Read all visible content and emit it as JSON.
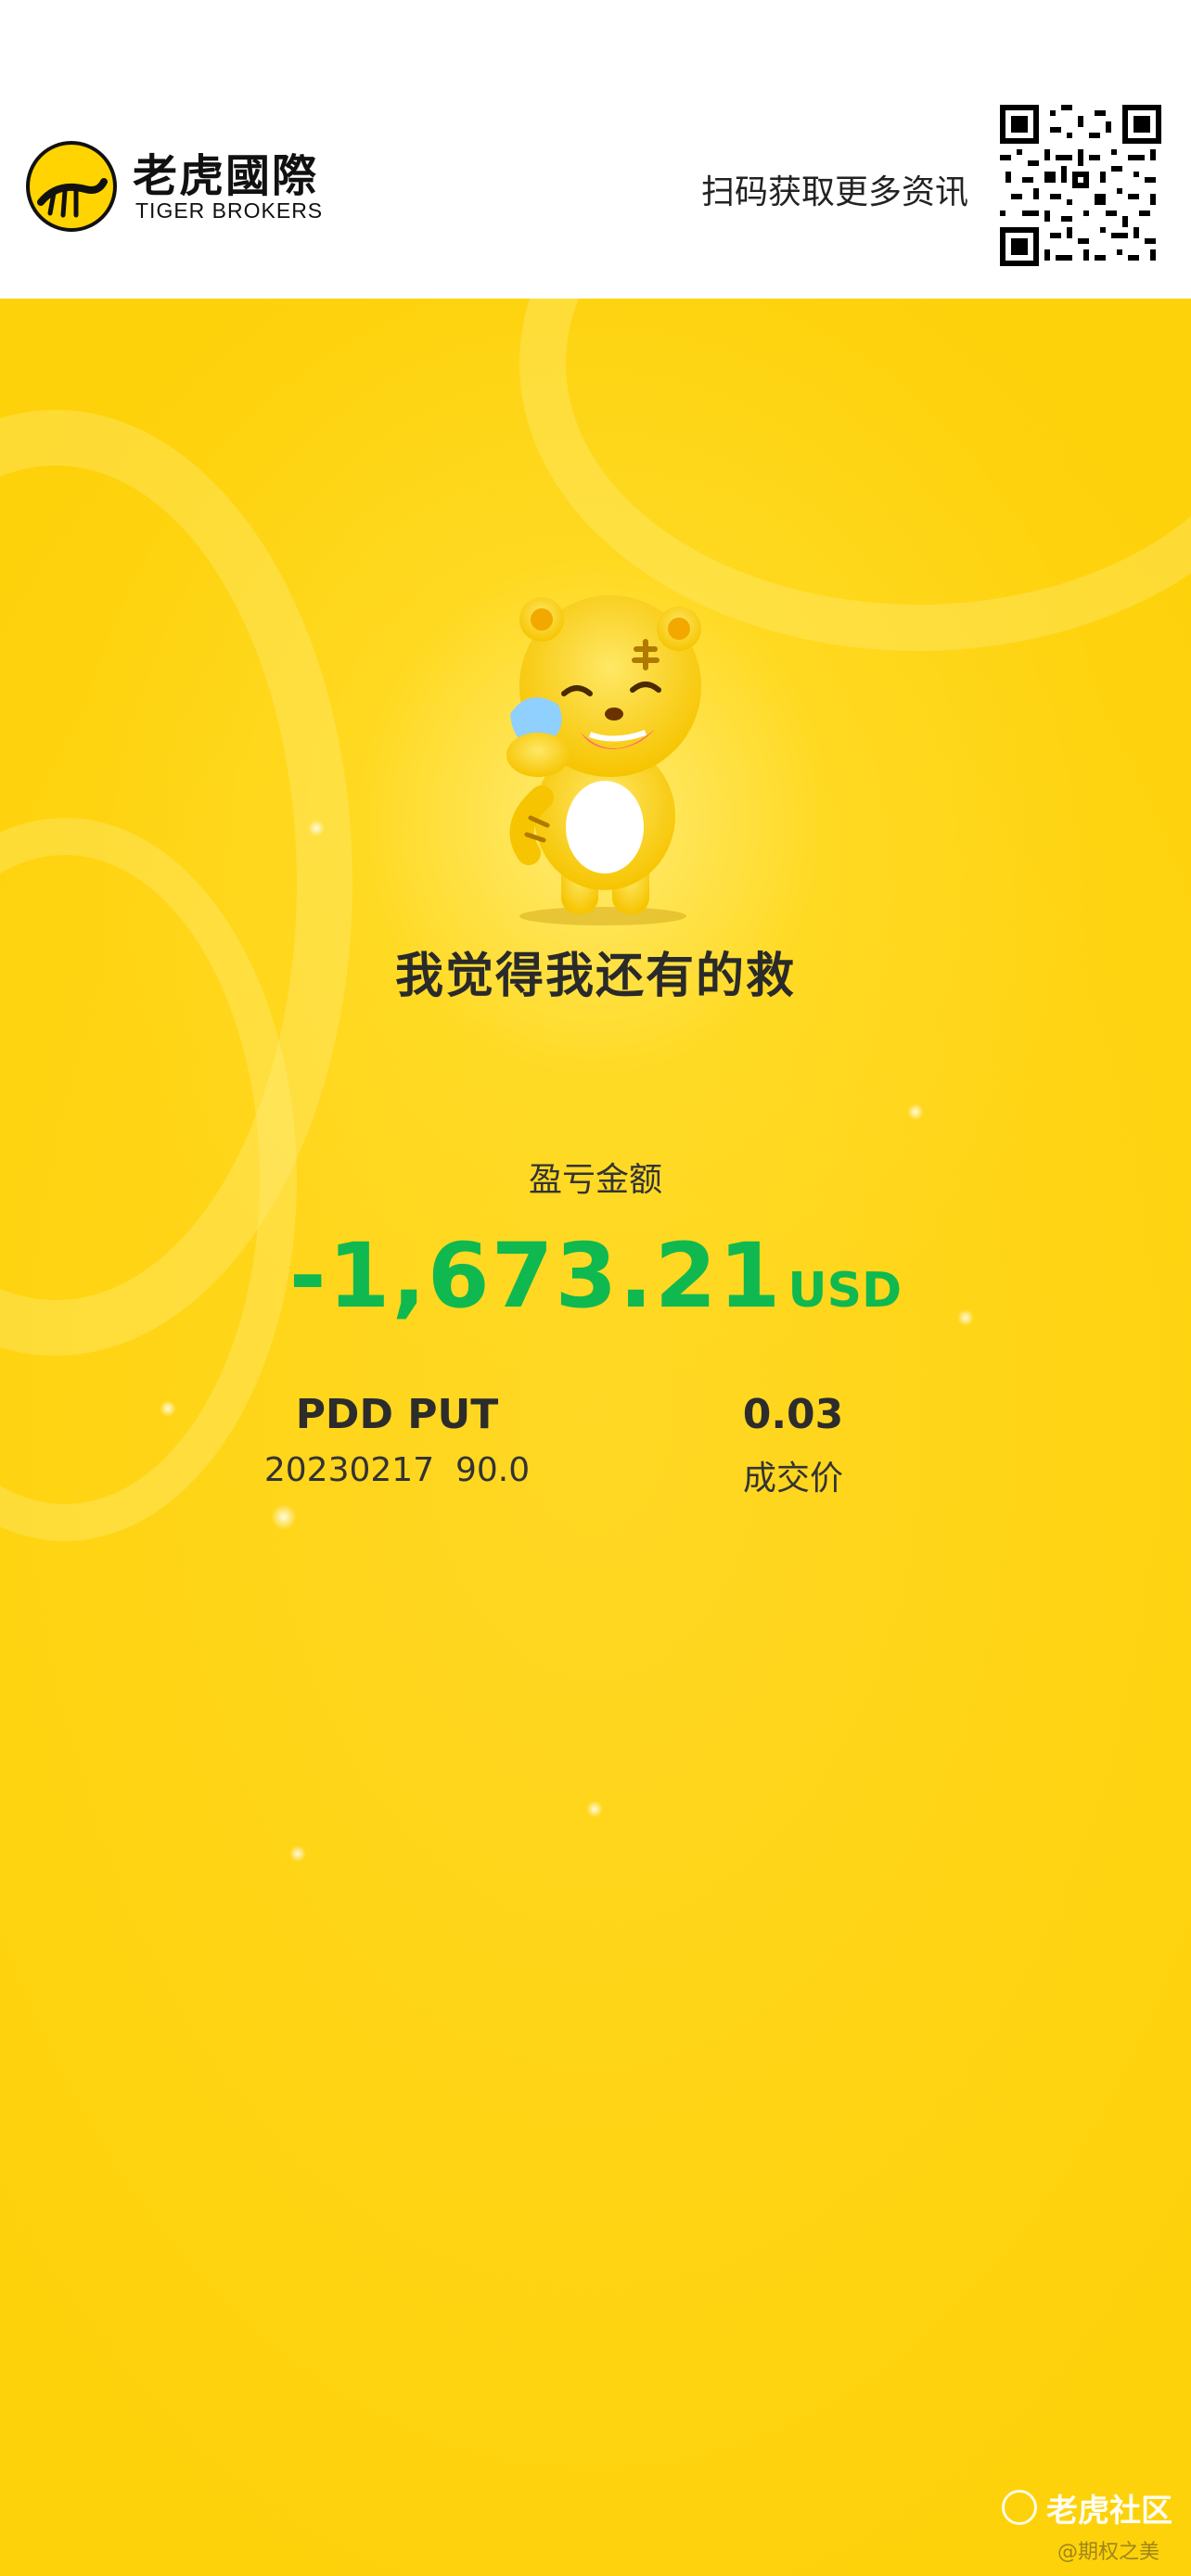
{
  "header": {
    "logo_cn": "老虎國際",
    "logo_en": "TIGER BROKERS",
    "scan_text": "扫码获取更多资讯"
  },
  "poster": {
    "headline": "我觉得我还有的救",
    "pnl_label": "盈亏金额",
    "pnl_value": "-1,673.21",
    "pnl_unit": "USD",
    "contract_name": "PDD PUT",
    "contract_detail": "20230217  90.0",
    "price_value": "0.03",
    "price_label": "成交价"
  },
  "footer": {
    "community_label": "老虎社区",
    "watermark": "@期权之美"
  },
  "colors": {
    "brand_yellow": "#ffd414",
    "loss_green": "#10b850",
    "text_dark": "#2a2a2a"
  }
}
